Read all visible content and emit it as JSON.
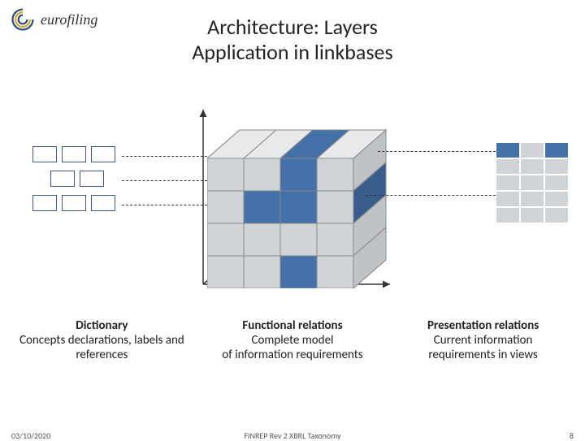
{
  "logo": {
    "text": "eurofiling"
  },
  "title": {
    "line1": "Architecture: Layers",
    "line2": "Application in linkbases"
  },
  "labels": {
    "dictionary": {
      "heading": "Dictionary",
      "desc": "Concepts declarations, labels and references"
    },
    "functional": {
      "heading": "Functional relations",
      "desc1": "Complete model",
      "desc2": "of information requirements"
    },
    "presentation": {
      "heading": "Presentation relations",
      "desc1": "Current information",
      "desc2": "requirements in views"
    }
  },
  "footer": {
    "date": "03/10/2020",
    "center": "FINREP Rev 2 XBRL Taxonomy",
    "page": "8"
  },
  "colors": {
    "blue": "#4472a8",
    "grey": "#d0d3d6",
    "axis": "#333"
  }
}
